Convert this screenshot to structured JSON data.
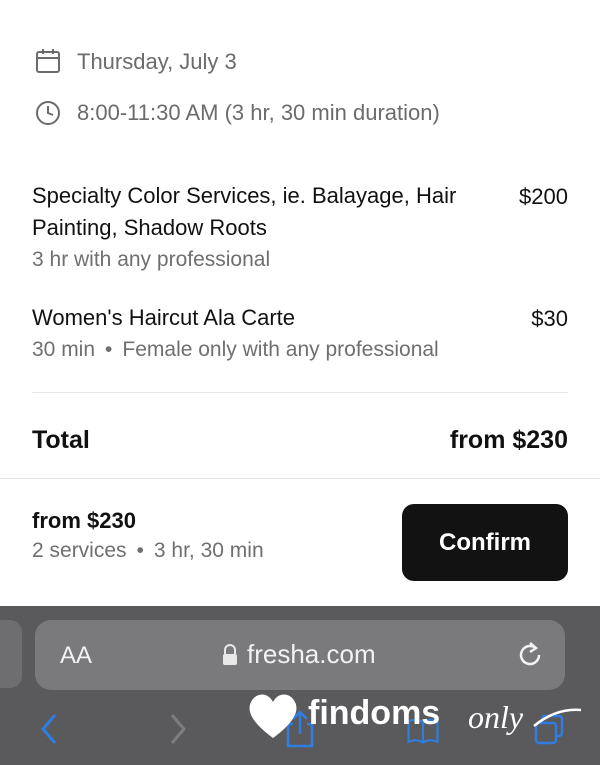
{
  "booking": {
    "date": "Thursday, July 3",
    "time": "8:00-11:30 AM (3 hr, 30 min duration)"
  },
  "services": [
    {
      "name": "Specialty Color Services, ie. Balayage, Hair Painting, Shadow Roots",
      "price": "$200",
      "detail_duration": "3 hr with any professional",
      "detail_note": ""
    },
    {
      "name": "Women's Haircut Ala Carte",
      "price": "$30",
      "detail_duration": "30 min",
      "detail_note": "Female only with any professional"
    }
  ],
  "separator": "•",
  "total": {
    "label": "Total",
    "value": "from $230"
  },
  "footer": {
    "price": "from $230",
    "services_count": "2 services",
    "duration": "3 hr, 30 min",
    "confirm_label": "Confirm"
  },
  "browser": {
    "text_size_label": "AA",
    "url": "fresha.com"
  },
  "watermark": {
    "text": "findoms",
    "script_text": "only"
  },
  "icons": {
    "date": "calendar-icon",
    "time": "clock-icon",
    "lock": "lock-icon",
    "reload": "reload-icon",
    "back": "back-chevron-icon",
    "forward": "forward-chevron-icon",
    "share": "share-icon",
    "bookmarks": "bookmarks-icon",
    "tabs": "tabs-icon"
  },
  "colors": {
    "confirm_bg": "#121212",
    "browser_bar": "#5a5a5c",
    "nav_blue": "#2f7de1"
  }
}
